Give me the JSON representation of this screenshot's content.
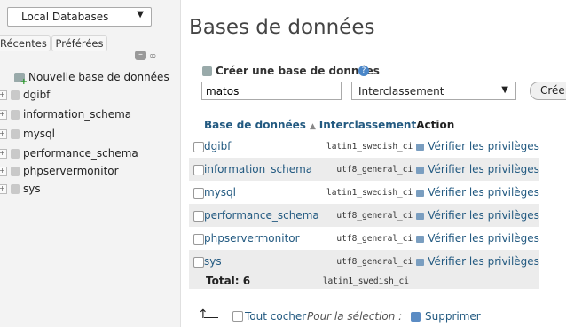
{
  "nav": {
    "server_select": "Local Databases",
    "tabs": [
      "Récentes",
      "Préférées"
    ],
    "new_db": "Nouvelle base de données",
    "databases": [
      "dgibf",
      "information_schema",
      "mysql",
      "performance_schema",
      "phpservermonitor",
      "sys"
    ]
  },
  "main": {
    "title": "Bases de données",
    "create_label": "Créer une base de données",
    "dbname_value": "matos",
    "collation_placeholder": "Interclassement",
    "create_button": "Créer"
  },
  "table": {
    "headers": [
      "Base de données",
      "Interclassement",
      "Action"
    ],
    "rows": [
      {
        "name": "dgibf",
        "collation": "latin1_swedish_ci",
        "action": "Vérifier les privilèges"
      },
      {
        "name": "information_schema",
        "collation": "utf8_general_ci",
        "action": "Vérifier les privilèges"
      },
      {
        "name": "mysql",
        "collation": "latin1_swedish_ci",
        "action": "Vérifier les privilèges"
      },
      {
        "name": "performance_schema",
        "collation": "utf8_general_ci",
        "action": "Vérifier les privilèges"
      },
      {
        "name": "phpservermonitor",
        "collation": "utf8_general_ci",
        "action": "Vérifier les privilèges"
      },
      {
        "name": "sys",
        "collation": "utf8_general_ci",
        "action": "Vérifier les privilèges"
      }
    ],
    "total_label": "Total: 6",
    "total_collation": "latin1_swedish_ci"
  },
  "footer": {
    "check_all": "Tout cocher",
    "selection": "Pour la sélection :",
    "delete": "Supprimer"
  }
}
